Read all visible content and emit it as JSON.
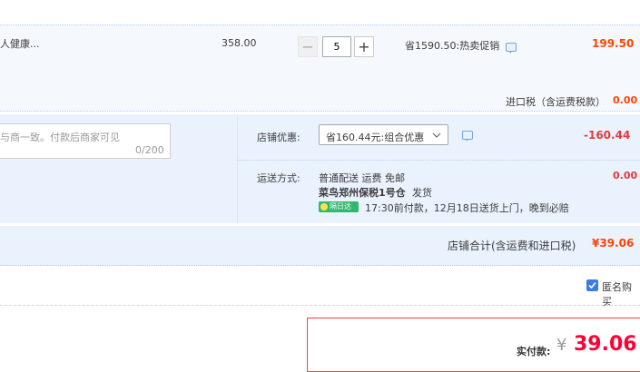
{
  "item": {
    "name_fragment": "人健康...",
    "unit_price": "358.00",
    "quantity": "5",
    "minus": "−",
    "plus": "+",
    "promo": "省1590.50:热卖促销",
    "subtotal": "199.50",
    "tax_label": "进口税（含运费税款）",
    "tax_value": "0.00"
  },
  "message": {
    "placeholder_fragment": "与商一致。付款后商家可见",
    "counter": "0/200"
  },
  "discount": {
    "label": "店铺优惠:",
    "selected": "省160.44元:组合优惠",
    "value": "-160.44"
  },
  "shipping": {
    "label": "运送方式:",
    "method": "普通配送 运费 免邮",
    "warehouse": "菜鸟郑州保税1号仓",
    "ship_text": "发货",
    "badge": "隔日达",
    "promise": "17:30前付款，12月18日送货上门，晚到必赔",
    "cost": "0.00"
  },
  "total": {
    "label": "店铺合计(含运费和进口税)",
    "value": "¥39.06"
  },
  "anonymous": {
    "label": "匿名购买"
  },
  "payment": {
    "label": "实付款:",
    "currency": "¥",
    "amount": "39.06"
  },
  "colors": {
    "accent_orange": "#ff4400",
    "accent_red": "#e4393c",
    "badge_green": "#31b86f",
    "checkbox_blue": "#3b7ce6"
  }
}
